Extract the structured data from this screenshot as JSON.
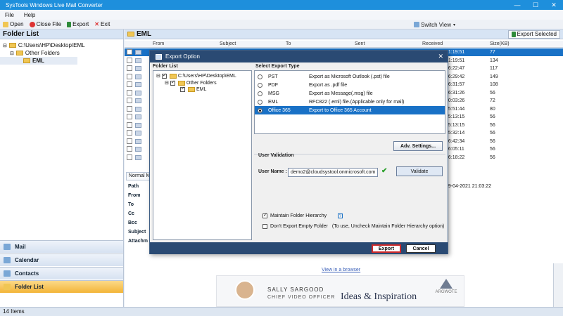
{
  "app": {
    "title": "SysTools Windows Live Mail Converter",
    "window_controls": [
      "—",
      "☐",
      "✕"
    ]
  },
  "menu": [
    "File",
    "Help"
  ],
  "toolbar": {
    "open": "Open",
    "close_file": "Close File",
    "export": "Export",
    "exit": "Exit",
    "switch_view": "Switch View"
  },
  "folder_list": {
    "title": "Folder List",
    "tree": [
      "C:\\Users\\HP\\Desktop\\EML",
      "Other Folders",
      "EML"
    ]
  },
  "nav": [
    "Mail",
    "Calendar",
    "Contacts",
    "Folder List"
  ],
  "status": {
    "items": "14 Items"
  },
  "main": {
    "title": "EML",
    "export_selected": "Export Selected",
    "columns": {
      "from": "From",
      "subject": "Subject",
      "to": "To",
      "sent": "Sent",
      "received": "Received",
      "size": "Size(KB)"
    },
    "rows": [
      {
        "time": "21:19:51",
        "size": "77"
      },
      {
        "time": "21:19:51",
        "size": "134"
      },
      {
        "time": "16:22:47",
        "size": "117"
      },
      {
        "time": "16:29:42",
        "size": "149"
      },
      {
        "time": "16:31:57",
        "size": "108"
      },
      {
        "time": "16:31:26",
        "size": "56"
      },
      {
        "time": "00:03:26",
        "size": "72"
      },
      {
        "time": "15:51:44",
        "size": "80"
      },
      {
        "time": "15:13:15",
        "size": "56"
      },
      {
        "time": "15:13:15",
        "size": "56"
      },
      {
        "time": "15:32:14",
        "size": "56"
      },
      {
        "time": "16:42:34",
        "size": "56"
      },
      {
        "time": "16:05:11",
        "size": "56"
      },
      {
        "time": "16:18:22",
        "size": "56"
      }
    ],
    "preview_tab": "Normal M",
    "preview_labels": [
      "Path",
      "From",
      "To",
      "Cc",
      "Bcc",
      "Subject",
      "Attachm"
    ],
    "preview_date": "29-04-2021 21:03:22",
    "view_link": "View in a browser",
    "banner": {
      "name": "SALLY SARGOOD",
      "role": "CHIEF VIDEO OFFICER",
      "headline": "Ideas & Inspiration",
      "logo_text": "ARGWOTE"
    }
  },
  "dialog": {
    "title": "Export Option",
    "folder_list_label": "Folder List",
    "tree": [
      "C:\\Users\\HP\\Desktop\\EML",
      "Other Folders",
      "EML"
    ],
    "export_type_label": "Select Export Type",
    "export_types": [
      {
        "name": "PST",
        "desc": "Export as Microsoft Outlook (.pst) file"
      },
      {
        "name": "PDF",
        "desc": "Export as .pdf file"
      },
      {
        "name": "MSG",
        "desc": "Export as Message(.msg) file"
      },
      {
        "name": "EML",
        "desc": "RFC822 (.eml) file.(Applicable only for mail)"
      },
      {
        "name": "Office 365",
        "desc": "Export to Office 365 Account"
      }
    ],
    "selected_type": "Office 365",
    "adv_settings": "Adv. Settings...",
    "user_validation_label": "User Validation",
    "user_name_label": "User Name :",
    "user_name_value": "demo2@cloudsystool.onmicrosoft.com",
    "validate": "Validate",
    "maintain_hierarchy": "Maintain Folder Hierarchy",
    "maintain_hierarchy_checked": true,
    "help_glyph": "?",
    "dont_export_empty": "Don't Export Empty Folder",
    "dont_export_note": "(To use, Uncheck Maintain Folder Hierarchy option)",
    "export_button": "Export",
    "cancel_button": "Cancel"
  },
  "colors": {
    "accent": "#1971c6",
    "title_bar": "#1e8fdc",
    "dialog_bar": "#2a4a73",
    "active_nav": "#f3b538",
    "danger": "#d02a2a"
  }
}
